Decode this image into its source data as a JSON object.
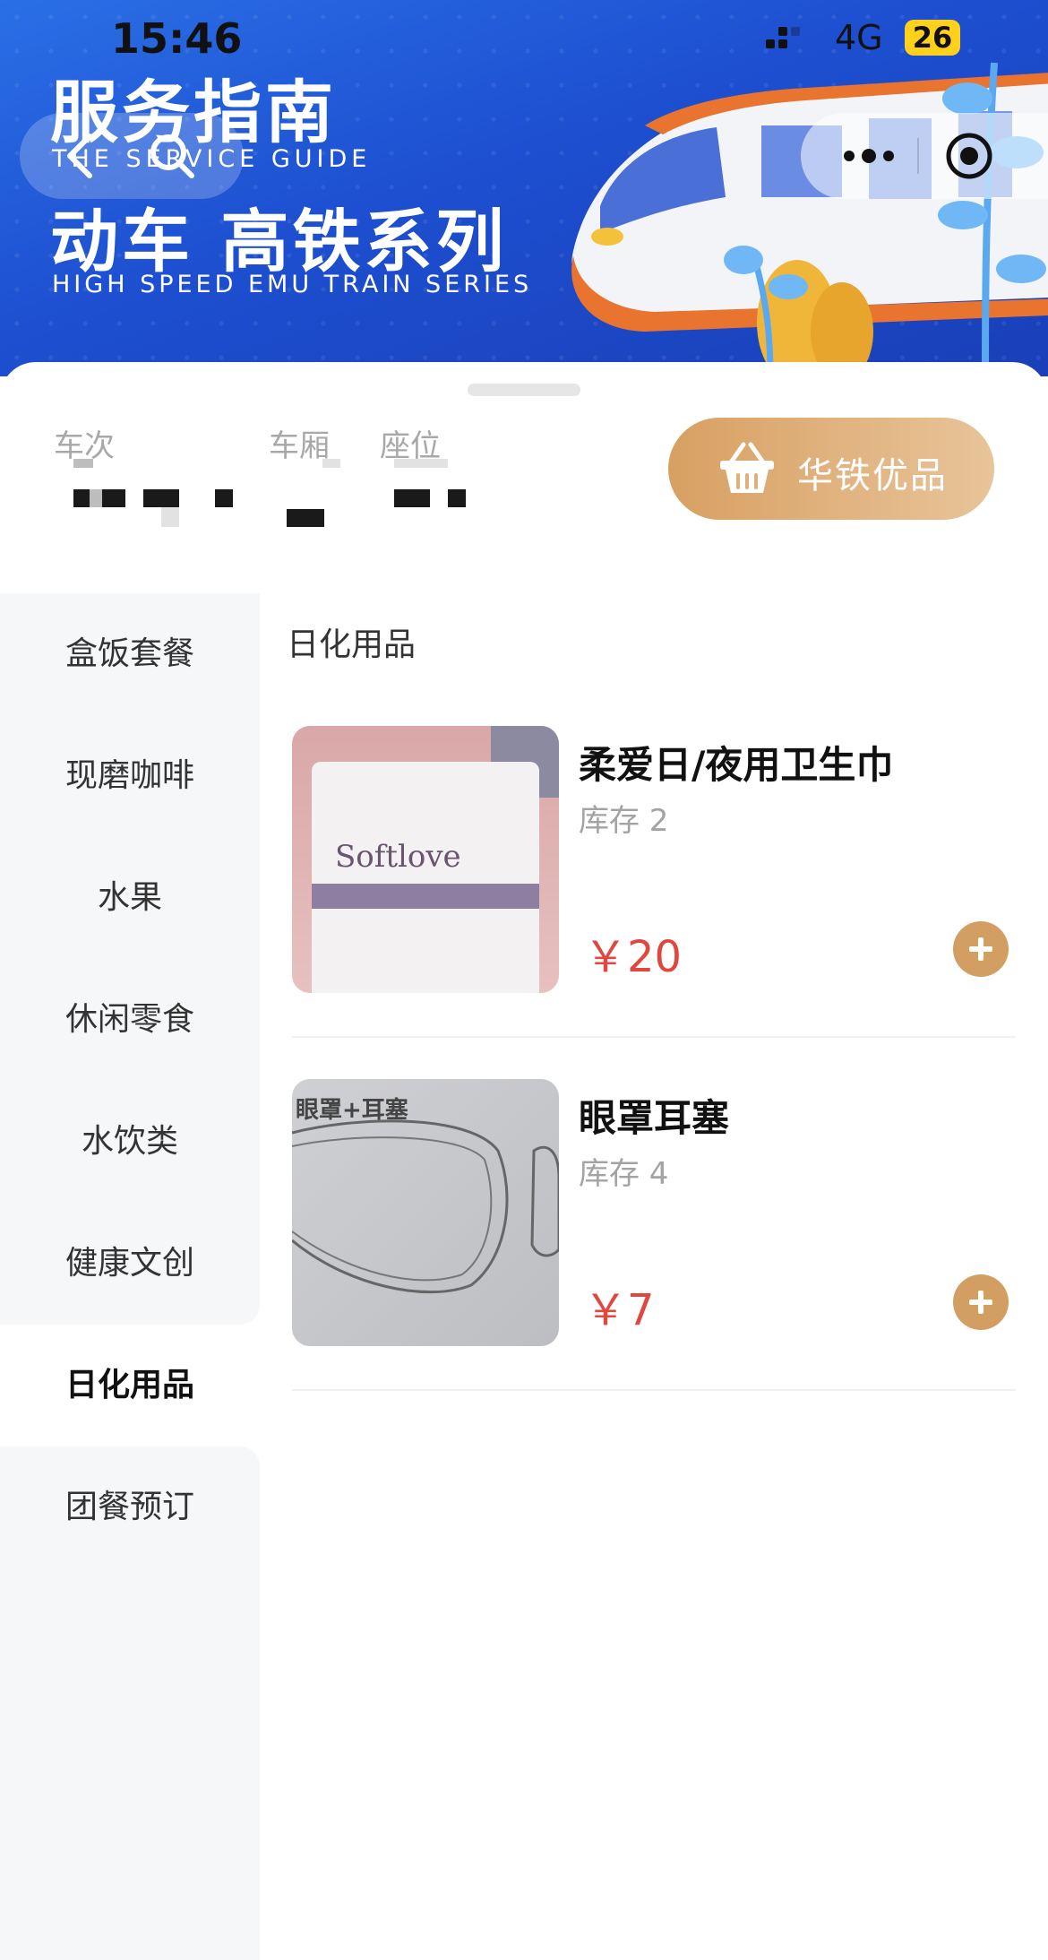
{
  "status_bar": {
    "time": "15:46",
    "network": "4G",
    "battery": "26"
  },
  "banner": {
    "title_cn": "服务指南",
    "subtitle_en": "THE SERVICE GUIDE",
    "title_cn_2": "动车 高铁系列",
    "subtitle_en_2": "HIGH SPEED EMU TRAIN SERIES"
  },
  "info": {
    "train_label": "车次",
    "carriage_label": "车厢",
    "seat_label": "座位"
  },
  "shop_button": {
    "label": "华铁优品"
  },
  "sidebar": {
    "items": [
      {
        "label": "盒饭套餐"
      },
      {
        "label": "现磨咖啡"
      },
      {
        "label": "水果"
      },
      {
        "label": "休闲零食"
      },
      {
        "label": "水饮类"
      },
      {
        "label": "健康文创"
      },
      {
        "label": "日化用品"
      },
      {
        "label": "团餐预订"
      }
    ],
    "active_index": 6
  },
  "section": {
    "title": "日化用品"
  },
  "products": [
    {
      "name": "柔爱日/夜用卫生巾",
      "stock": "库存 2",
      "price": "￥20",
      "thumb_text": "Softlove"
    },
    {
      "name": "眼罩耳塞",
      "stock": "库存 4",
      "price": "￥7",
      "thumb_text": "眼罩+耳塞"
    }
  ],
  "colors": {
    "accent_gold": "#d39e62",
    "price_red": "#e0473f",
    "banner_blue": "#1d4fd0"
  },
  "icons": [
    "back-icon",
    "search-icon",
    "more-icon",
    "target-icon",
    "basket-icon",
    "add-icon"
  ]
}
